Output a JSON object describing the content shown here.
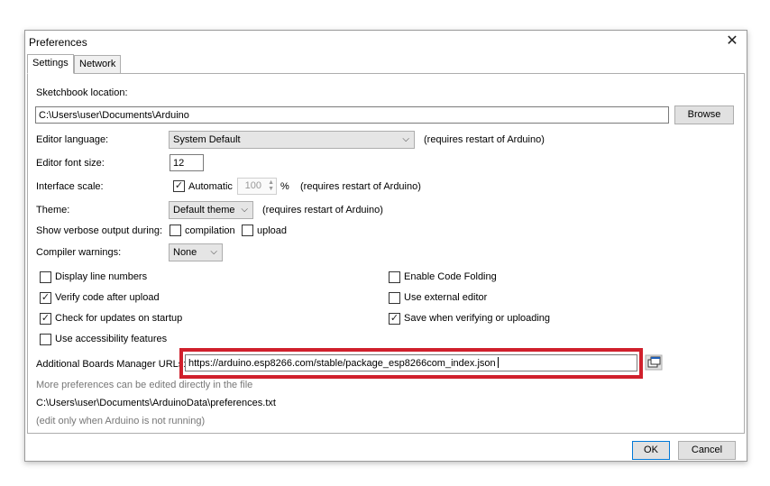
{
  "window": {
    "title": "Preferences",
    "close_glyph": "✕"
  },
  "tabs": [
    {
      "label": "Settings"
    },
    {
      "label": "Network"
    }
  ],
  "sketchbook": {
    "label": "Sketchbook location:",
    "value": "C:\\Users\\user\\Documents\\Arduino",
    "browse": "Browse"
  },
  "editor_language": {
    "label": "Editor language:",
    "value": "System Default",
    "note": "(requires restart of Arduino)"
  },
  "font_size": {
    "label": "Editor font size:",
    "value": "12"
  },
  "interface_scale": {
    "label": "Interface scale:",
    "auto_label": "Automatic",
    "value": "100",
    "unit": "%",
    "note": "(requires restart of Arduino)"
  },
  "theme": {
    "label": "Theme:",
    "value": "Default theme",
    "note": "(requires restart of Arduino)"
  },
  "verbose": {
    "label": "Show verbose output during:",
    "compilation": "compilation",
    "upload": "upload"
  },
  "warnings": {
    "label": "Compiler warnings:",
    "value": "None"
  },
  "options_left": [
    {
      "label": "Display line numbers",
      "checked": false
    },
    {
      "label": "Verify code after upload",
      "checked": true
    },
    {
      "label": "Check for updates on startup",
      "checked": true
    },
    {
      "label": "Use accessibility features",
      "checked": false
    }
  ],
  "options_right": [
    {
      "label": "Enable Code Folding",
      "checked": false
    },
    {
      "label": "Use external editor",
      "checked": false
    },
    {
      "label": "Save when verifying or uploading",
      "checked": true
    }
  ],
  "boards": {
    "label": "Additional Boards Manager URLs:",
    "value": "https://arduino.esp8266.com/stable/package_esp8266com_index.json"
  },
  "more_prefs": "More preferences can be edited directly in the file",
  "prefs_path": "C:\\Users\\user\\Documents\\ArduinoData\\preferences.txt",
  "edit_note": "(edit only when Arduino is not running)",
  "buttons": {
    "ok": "OK",
    "cancel": "Cancel"
  },
  "colors": {
    "highlight": "#d0202c",
    "accent": "#0078d7"
  },
  "icons": {
    "check": "✓",
    "arrow": "⌵"
  }
}
